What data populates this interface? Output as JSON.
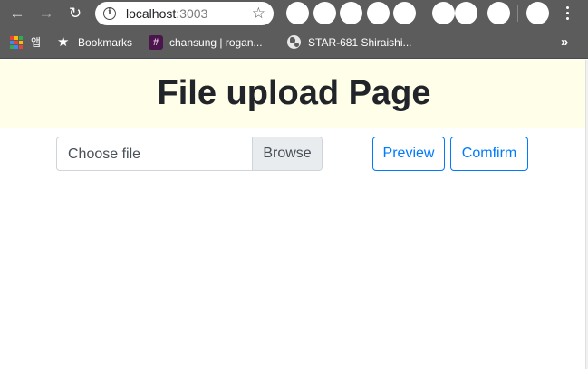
{
  "browser": {
    "back_icon": "arrow-left-icon",
    "forward_icon": "arrow-right-icon",
    "reload_icon": "reload-icon",
    "address": {
      "host": "localhost",
      "port": ":3003"
    },
    "bookmark_star_icon": "star-outline-icon",
    "menu_icon": "three-dots-vertical-icon"
  },
  "bookmarks_bar": {
    "apps_label": "앱",
    "items": [
      {
        "label": "Bookmarks",
        "icon": "star-icon"
      },
      {
        "label": "chansung | rogan...",
        "icon": "slack-icon"
      },
      {
        "label": "STAR-681 Shiraishi...",
        "icon": "globe-icon"
      }
    ],
    "overflow_icon": "double-chevron-right-icon"
  },
  "page": {
    "title": "File upload Page",
    "file_input": {
      "placeholder": "Choose file",
      "browse_label": "Browse"
    },
    "buttons": {
      "preview_label": "Preview",
      "confirm_label": "Comfirm"
    },
    "colors": {
      "hero_background": "#fefee9",
      "primary": "#007bff",
      "browser_chrome": "#5c5c5c"
    }
  }
}
